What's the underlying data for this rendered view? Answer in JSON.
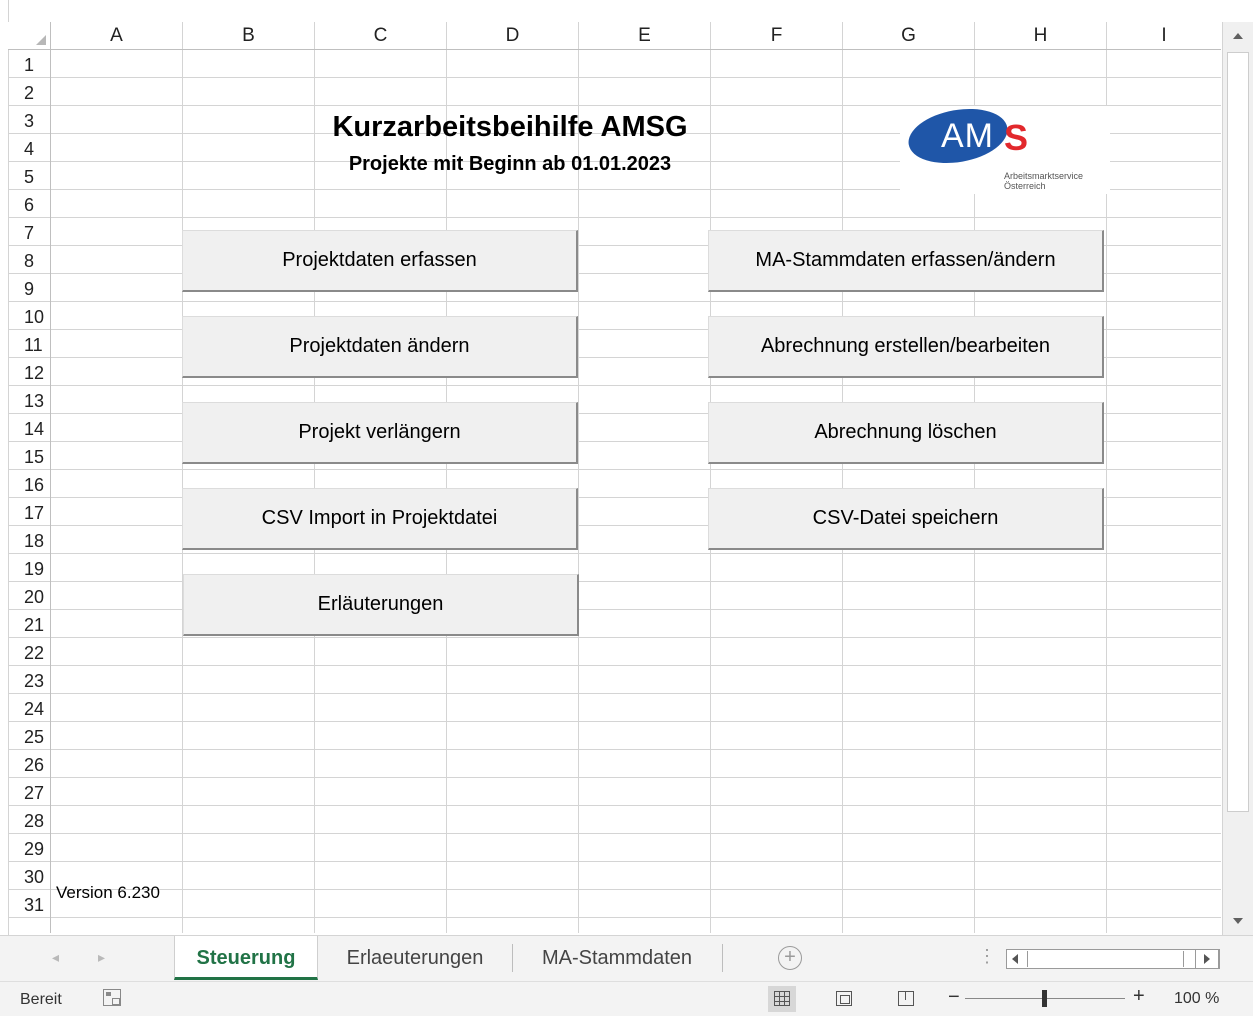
{
  "spreadsheet": {
    "columns": [
      "A",
      "B",
      "C",
      "D",
      "E",
      "F",
      "G",
      "H",
      "I"
    ],
    "rows": [
      "1",
      "2",
      "3",
      "4",
      "5",
      "6",
      "7",
      "8",
      "9",
      "10",
      "11",
      "12",
      "13",
      "14",
      "15",
      "16",
      "17",
      "18",
      "19",
      "20",
      "21",
      "22",
      "23",
      "24",
      "25",
      "26",
      "27",
      "28",
      "29",
      "30",
      "31"
    ],
    "title": "Kurzarbeitsbeihilfe AMSG",
    "subtitle": "Projekte mit Beginn ab 01.01.2023",
    "version": "Version 6.230"
  },
  "logo": {
    "mark_left": "AM",
    "mark_right": "S",
    "line1": "Arbeitsmarktservice",
    "line2": "Österreich",
    "blue": "#1f56a8",
    "red": "#e2282c"
  },
  "buttons": {
    "projektdaten_erfassen": "Projektdaten erfassen",
    "projektdaten_aendern": "Projektdaten ändern",
    "projekt_verlaengern": "Projekt verlängern",
    "csv_import": "CSV Import in Projektdatei",
    "erlaeuterungen": "Erläuterungen",
    "ma_stammdaten": "MA-Stammdaten erfassen/ändern",
    "abrechnung_erstellen": "Abrechnung erstellen/bearbeiten",
    "abrechnung_loeschen": "Abrechnung löschen",
    "csv_speichern": "CSV-Datei speichern"
  },
  "sheet_tabs": {
    "prev": "◂",
    "next": "▸",
    "tab1": "Steuerung",
    "tab2": "Erlaeuterungen",
    "tab3": "MA-Stammdaten",
    "add": "+",
    "more": "⋮"
  },
  "status_bar": {
    "ready": "Bereit",
    "zoom_minus": "−",
    "zoom_plus": "+",
    "zoom_level": "100 %",
    "zoom_fraction": 0.5
  },
  "colors": {
    "accent": "#217346",
    "button_face": "#f0f0f0"
  }
}
